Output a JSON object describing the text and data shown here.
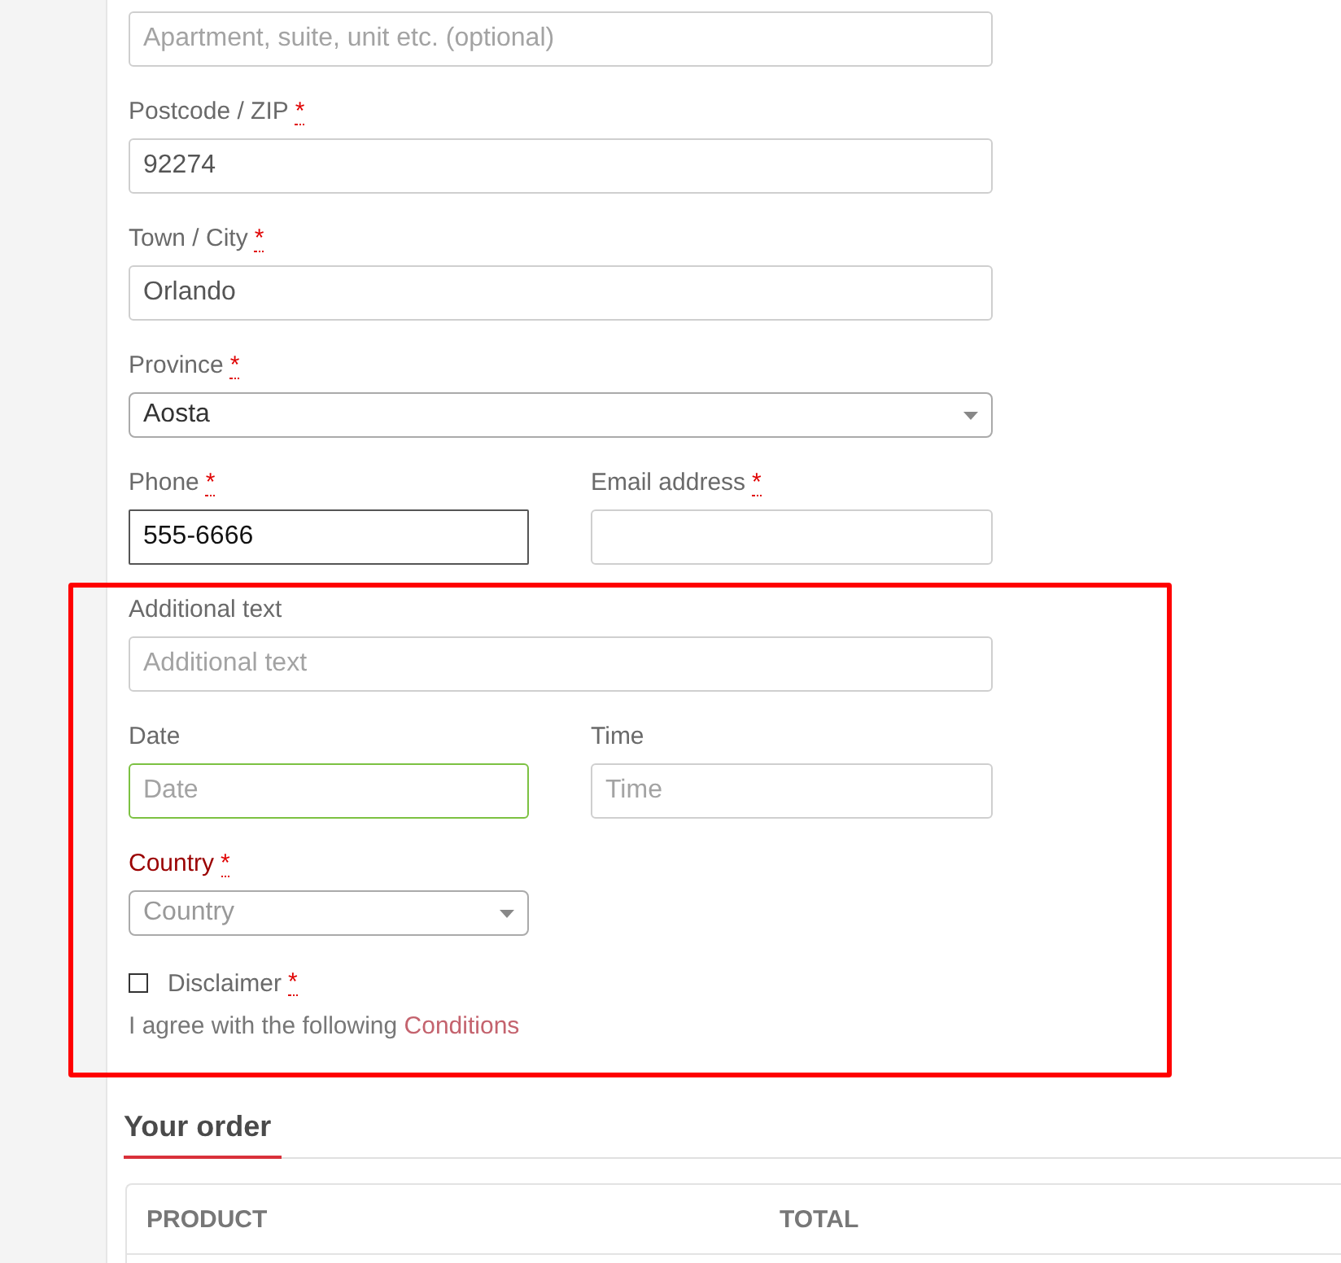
{
  "billing_rows": [
    {
      "fields": [
        {
          "kind": "input",
          "placeholder": "Apartment, suite, unit etc. (optional)",
          "focused": false,
          "validated": false,
          "invalid": false
        }
      ]
    },
    {
      "fields": [
        {
          "kind": "input",
          "label": "Postcode / ZIP",
          "required_mark": "*",
          "value": "92274",
          "focused": false,
          "validated": false,
          "invalid": false
        }
      ]
    },
    {
      "fields": [
        {
          "kind": "input",
          "label": "Town / City",
          "required_mark": "*",
          "value": "Orlando",
          "focused": false,
          "validated": false,
          "invalid": false
        }
      ]
    },
    {
      "fields": [
        {
          "kind": "select",
          "label": "Province",
          "required_mark": "*",
          "value": "Aosta",
          "focused": false,
          "validated": false,
          "invalid": false
        }
      ]
    },
    {
      "fields": [
        {
          "kind": "input",
          "label": "Phone",
          "required_mark": "*",
          "value": "555-6666",
          "focused": true,
          "validated": false,
          "invalid": false
        },
        {
          "kind": "input",
          "label": "Email address",
          "required_mark": "*",
          "focused": false,
          "validated": false,
          "invalid": false
        }
      ]
    }
  ],
  "highlighted_rows": [
    {
      "fields": [
        {
          "kind": "input",
          "label": "Additional text",
          "placeholder": "Additional text",
          "focused": false,
          "validated": false,
          "invalid": false
        }
      ]
    },
    {
      "fields": [
        {
          "kind": "input",
          "label": "Date",
          "placeholder": "Date",
          "focused": false,
          "validated": true,
          "invalid": false
        },
        {
          "kind": "input",
          "label": "Time",
          "placeholder": "Time",
          "focused": false,
          "validated": false,
          "invalid": false
        }
      ]
    },
    {
      "fields": [
        {
          "kind": "select",
          "label": "Country",
          "required_mark": "*",
          "placeholder": "Country",
          "focused": false,
          "validated": false,
          "invalid": true
        }
      ]
    },
    {
      "fields": [
        {
          "kind": "checkbox",
          "label": "Disclaimer",
          "required_mark": "*",
          "checked": false,
          "description": "I agree with the following",
          "link": "Conditions"
        }
      ]
    }
  ],
  "order": {
    "title": "Your order",
    "columns": [
      "PRODUCT",
      "TOTAL"
    ]
  }
}
